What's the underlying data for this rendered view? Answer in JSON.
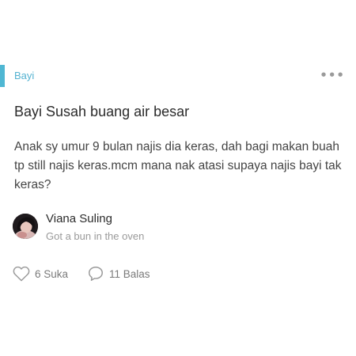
{
  "category": {
    "label": "Bayi",
    "accent_color": "#4fb7d3",
    "more_icon": "more-horizontal-icon",
    "more_glyph": "•••"
  },
  "post": {
    "title": "Bayi Susah buang air besar",
    "body": "Anak sy umur 9 bulan najis dia keras, dah bagi makan buah tp still najis keras.mcm mana nak atasi supaya najis bayi tak keras?"
  },
  "author": {
    "name": "Viana Suling",
    "status": "Got a bun in the oven"
  },
  "actions": {
    "like": {
      "icon": "heart-icon",
      "label": "6 Suka"
    },
    "reply": {
      "icon": "comment-icon",
      "label": "11 Balas"
    }
  }
}
